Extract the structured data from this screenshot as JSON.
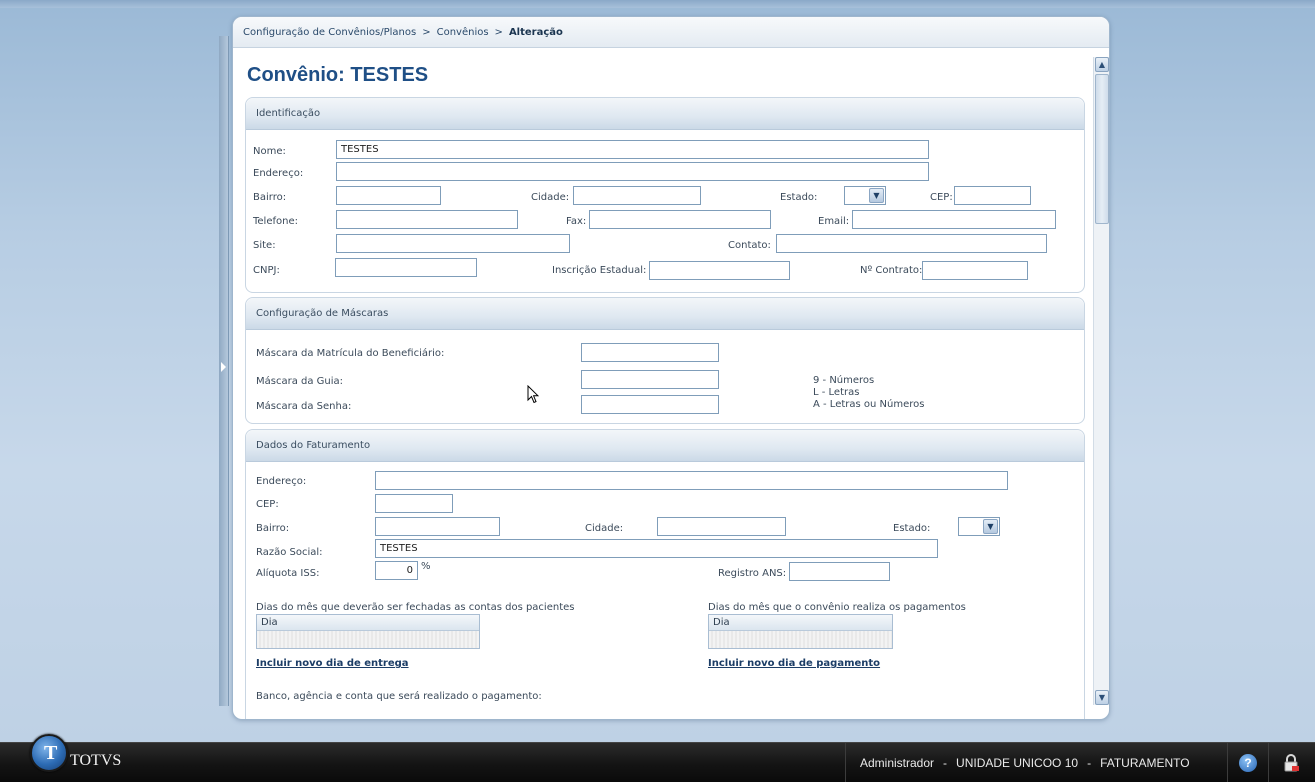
{
  "breadcrumb": {
    "item1": "Configuração de Convênios/Planos",
    "item2": "Convênios",
    "current": "Alteração",
    "separator": ">"
  },
  "page_title": "Convênio: TESTES",
  "identificacao": {
    "title": "Identificação",
    "nome_label": "Nome:",
    "nome_value": "TESTES",
    "endereco_label": "Endereço:",
    "endereco_value": "",
    "bairro_label": "Bairro:",
    "cidade_label": "Cidade:",
    "estado_label": "Estado:",
    "cep_label": "CEP:",
    "telefone_label": "Telefone:",
    "fax_label": "Fax:",
    "email_label": "Email:",
    "site_label": "Site:",
    "contato_label": "Contato:",
    "cnpj_label": "CNPJ:",
    "inscricao_label": "Inscrição Estadual:",
    "contrato_label": "Nº Contrato:"
  },
  "mascaras": {
    "title": "Configuração de Máscaras",
    "matricula_label": "Máscara da Matrícula do Beneficiário:",
    "guia_label": "Máscara da Guia:",
    "senha_label": "Máscara da Senha:",
    "legend_numeros": "9 - Números",
    "legend_letras": "L - Letras",
    "legend_ambos": "A - Letras ou Números"
  },
  "faturamento": {
    "title": "Dados do Faturamento",
    "endereco_label": "Endereço:",
    "cep_label": "CEP:",
    "bairro_label": "Bairro:",
    "cidade_label": "Cidade:",
    "estado_label": "Estado:",
    "razao_label": "Razão Social:",
    "razao_value": "TESTES",
    "aliquota_label": "Alíquota ISS:",
    "aliquota_value": "0",
    "aliquota_unit": "%",
    "registro_label": "Registro ANS:",
    "dias_fechamento_label": "Dias do mês que deverão ser fechadas as contas dos pacientes",
    "dias_pagamento_label": "Dias do mês que o convênio realiza os pagamentos",
    "dia_col": "Dia",
    "incluir_entrega": "Incluir novo dia de entrega",
    "incluir_pagamento": "Incluir novo dia de pagamento",
    "banco_label": "Banco, agência e conta que será realizado o pagamento:"
  },
  "taskbar": {
    "brand": "TOTVS",
    "user": "Administrador",
    "unit": "UNIDADE UNICOO 10",
    "module": "FATURAMENTO",
    "separator": "-"
  },
  "icons": {
    "dropdown": "chevron-down-icon",
    "help": "help-icon",
    "lock": "lock-icon",
    "cursor": "mouse-pointer-icon"
  },
  "colors": {
    "title": "#1f4f86",
    "link": "#1c3d66",
    "taskbar": "#141414"
  }
}
